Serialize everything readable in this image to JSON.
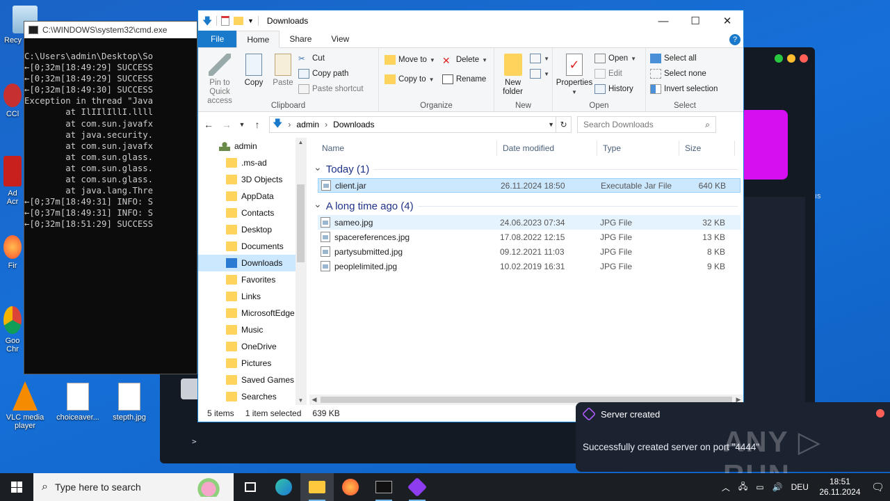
{
  "desktop": {
    "icons": [
      {
        "label": "Recy",
        "left": "",
        "top": ""
      },
      {
        "label": "CCl"
      },
      {
        "label": "Ad\nAcr"
      },
      {
        "label": "Fir"
      },
      {
        "label": "Goo\nChr"
      },
      {
        "label": "VLC media player"
      },
      {
        "label": "choiceaver..."
      },
      {
        "label": "stepth.jpg"
      }
    ],
    "side_text": "ıs"
  },
  "cmd": {
    "title": "C:\\WINDOWS\\system32\\cmd.exe",
    "lines": [
      "C:\\Users\\admin\\Desktop\\So",
      "←[0;32m[18:49:29] SUCCESS",
      "←[0;32m[18:49:29] SUCCESS",
      "←[0;32m[18:49:30] SUCCESS",
      "Exception in thread \"Java",
      "        at IlIIlIllI.llll",
      "        at com.sun.javafx",
      "        at java.security.",
      "        at com.sun.javafx",
      "        at com.sun.glass.",
      "        at com.sun.glass.",
      "        at com.sun.glass.",
      "        at java.lang.Thre",
      "←[0;37m[18:49:31] INFO: S",
      "←[0;37m[18:49:31] INFO: S",
      "←[0;32m[18:51:29] SUCCESS"
    ]
  },
  "darkapp": {
    "prompt": ">"
  },
  "explorer": {
    "title": "Downloads",
    "tabs": {
      "file": "File",
      "home": "Home",
      "share": "Share",
      "view": "View",
      "help": "?"
    },
    "ribbon": {
      "clipboard": {
        "label": "Clipboard",
        "pin": "Pin to Quick access",
        "copy": "Copy",
        "paste": "Paste",
        "cut": "Cut",
        "copy_path": "Copy path",
        "paste_shortcut": "Paste shortcut"
      },
      "organize": {
        "label": "Organize",
        "move_to": "Move to",
        "copy_to": "Copy to",
        "delete": "Delete",
        "rename": "Rename"
      },
      "new": {
        "label": "New",
        "new_folder": "New folder"
      },
      "open": {
        "label": "Open",
        "properties": "Properties",
        "open": "Open",
        "edit": "Edit",
        "history": "History"
      },
      "select": {
        "label": "Select",
        "select_all": "Select all",
        "select_none": "Select none",
        "invert": "Invert selection"
      }
    },
    "address": {
      "crumbs": [
        "admin",
        "Downloads"
      ],
      "search_placeholder": "Search Downloads"
    },
    "nav": [
      {
        "label": "admin",
        "root": true
      },
      {
        "label": ".ms-ad"
      },
      {
        "label": "3D Objects"
      },
      {
        "label": "AppData"
      },
      {
        "label": "Contacts"
      },
      {
        "label": "Desktop"
      },
      {
        "label": "Documents"
      },
      {
        "label": "Downloads",
        "selected": true
      },
      {
        "label": "Favorites"
      },
      {
        "label": "Links"
      },
      {
        "label": "MicrosoftEdge"
      },
      {
        "label": "Music"
      },
      {
        "label": "OneDrive"
      },
      {
        "label": "Pictures"
      },
      {
        "label": "Saved Games"
      },
      {
        "label": "Searches"
      }
    ],
    "columns": {
      "name": "Name",
      "date": "Date modified",
      "type": "Type",
      "size": "Size"
    },
    "groups": [
      {
        "title": "Today (1)",
        "files": [
          {
            "name": "client.jar",
            "date": "26.11.2024 18:50",
            "type": "Executable Jar File",
            "size": "640 KB",
            "selected": true
          }
        ]
      },
      {
        "title": "A long time ago (4)",
        "files": [
          {
            "name": "sameo.jpg",
            "date": "24.06.2023 07:34",
            "type": "JPG File",
            "size": "32 KB",
            "hover": true
          },
          {
            "name": "spacereferences.jpg",
            "date": "17.08.2022 12:15",
            "type": "JPG File",
            "size": "13 KB"
          },
          {
            "name": "partysubmitted.jpg",
            "date": "09.12.2021 11:03",
            "type": "JPG File",
            "size": "8 KB"
          },
          {
            "name": "peoplelimited.jpg",
            "date": "10.02.2019 16:31",
            "type": "JPG File",
            "size": "9 KB"
          }
        ]
      }
    ],
    "status": {
      "items": "5 items",
      "selected": "1 item selected",
      "size": "639 KB"
    }
  },
  "toast": {
    "title": "Server created",
    "message": "Successfully created server on port \"4444\""
  },
  "watermark": "ANY ▷ RUN",
  "taskbar": {
    "search_placeholder": "Type here to search",
    "language": "DEU",
    "time": "18:51",
    "date": "26.11.2024"
  }
}
